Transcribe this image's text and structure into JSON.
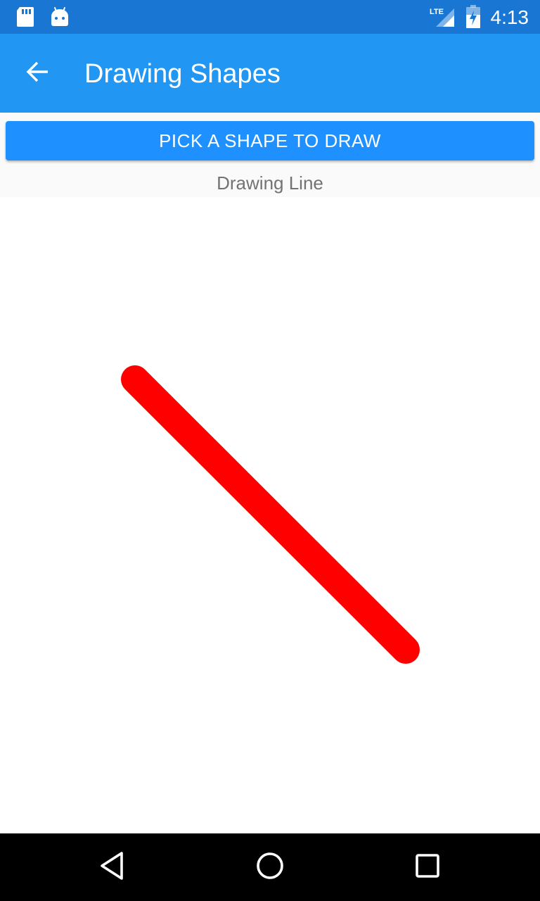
{
  "status_bar": {
    "time": "4:13",
    "network_label": "LTE",
    "icons": [
      "sd-card-icon",
      "android-icon",
      "lte-signal-icon",
      "battery-charging-icon"
    ],
    "color": "#1976D2"
  },
  "app_bar": {
    "title": "Drawing Shapes",
    "back_icon": "arrow-back-icon",
    "color": "#2196F3"
  },
  "pick_button": {
    "label": "PICK A SHAPE TO DRAW",
    "color": "#1E90FF"
  },
  "drawing_label": "Drawing Line",
  "canvas": {
    "shape": "line",
    "stroke_color": "#FF0000",
    "line_cap": "round"
  },
  "nav_bar": {
    "icons": [
      "back-triangle-icon",
      "home-circle-icon",
      "recents-square-icon"
    ]
  }
}
